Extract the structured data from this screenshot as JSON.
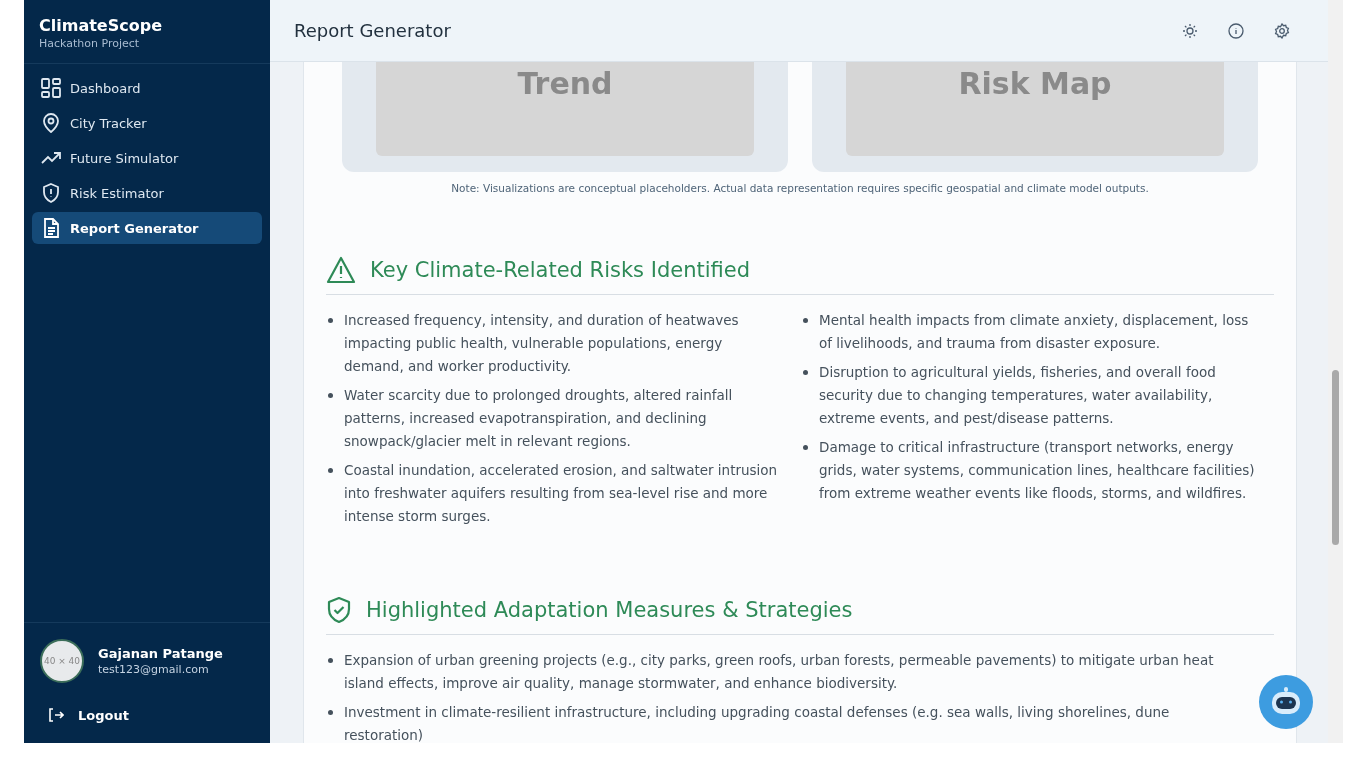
{
  "sidebar": {
    "brand": "ClimateScope",
    "subtitle": "Hackathon Project",
    "items": [
      {
        "label": "Dashboard",
        "kind": "grid",
        "selected": false
      },
      {
        "label": "City Tracker",
        "kind": "pin",
        "selected": false
      },
      {
        "label": "Future Simulator",
        "kind": "trend",
        "selected": false
      },
      {
        "label": "Risk Estimator",
        "kind": "shield",
        "selected": false
      },
      {
        "label": "Report Generator",
        "kind": "doc",
        "selected": true
      }
    ],
    "user": {
      "avatar": "40 × 40",
      "name": "Gajanan Patange",
      "email": "test123@gmail.com"
    },
    "logout": "Logout"
  },
  "header": {
    "title": "Report Generator"
  },
  "visuals": [
    {
      "label": "Trend"
    },
    {
      "label": "Risk Map"
    }
  ],
  "note": "Note: Visualizations are conceptual placeholders. Actual data representation requires specific geospatial and climate model outputs.",
  "sections": [
    {
      "kind": "risks",
      "title": "Key Climate-Related Risks Identified",
      "items": [
        "Increased frequency, intensity, and duration of heatwaves impacting public health, vulnerable populations, energy demand, and worker productivity.",
        "Water scarcity due to prolonged droughts, altered rainfall patterns, increased evapotranspiration, and declining snowpack/glacier melt in relevant regions.",
        "Coastal inundation, accelerated erosion, and saltwater intrusion into freshwater aquifers resulting from sea-level rise and more intense storm surges.",
        "Mental health impacts from climate anxiety, displacement, loss of livelihoods, and trauma from disaster exposure.",
        "Disruption to agricultural yields, fisheries, and overall food security due to changing temperatures, water availability, extreme events, and pest/disease patterns.",
        "Damage to critical infrastructure (transport networks, energy grids, water systems, communication lines, healthcare facilities) from extreme weather events like floods, storms, and wildfires."
      ]
    },
    {
      "kind": "measures",
      "title": "Highlighted Adaptation Measures & Strategies",
      "items": [
        "Expansion of urban greening projects (e.g., city parks, green roofs, urban forests, permeable pavements) to mitigate urban heat island effects, improve air quality, manage stormwater, and enhance biodiversity.",
        "Investment in climate-resilient infrastructure, including upgrading coastal defenses (e.g. sea walls, living shorelines, dune restoration)"
      ]
    }
  ]
}
